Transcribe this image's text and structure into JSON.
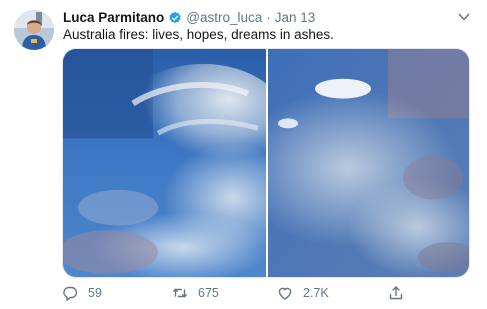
{
  "tweet": {
    "author_name": "Luca Parmitano",
    "handle": "@astro_luca",
    "separator": "·",
    "date": "Jan 13",
    "text": "Australia fires: lives, hopes, dreams in ashes."
  },
  "actions": {
    "replies": "59",
    "retweets": "675",
    "likes": "2.7K"
  },
  "icons": {
    "verified": "verified-badge-icon",
    "more": "chevron-down-icon",
    "reply": "reply-icon",
    "retweet": "retweet-icon",
    "like": "heart-icon",
    "share": "share-icon"
  },
  "colors": {
    "verified": "#1da1f2",
    "secondary_text": "#657786"
  }
}
